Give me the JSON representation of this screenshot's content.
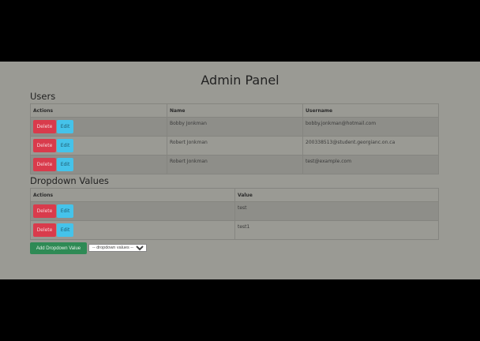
{
  "title": "Admin Panel",
  "users": {
    "heading": "Users",
    "columns": [
      "Actions",
      "Name",
      "Username"
    ],
    "rows": [
      {
        "name": "Bobby Jonkman",
        "username": "bobby.jonkman@hotmail.com"
      },
      {
        "name": "Robert Jonkman",
        "username": "200338513@student.georgianc.on.ca"
      },
      {
        "name": "Robert Jonkman",
        "username": "test@example.com"
      }
    ]
  },
  "dropdown": {
    "heading": "Dropdown Values",
    "columns": [
      "Actions",
      "Value"
    ],
    "rows": [
      {
        "value": "test"
      },
      {
        "value": "test1"
      }
    ]
  },
  "buttons": {
    "delete": "Delete",
    "edit": "Edit",
    "add": "Add Dropdown Value"
  },
  "select": {
    "selected": "-- dropdown values --"
  }
}
